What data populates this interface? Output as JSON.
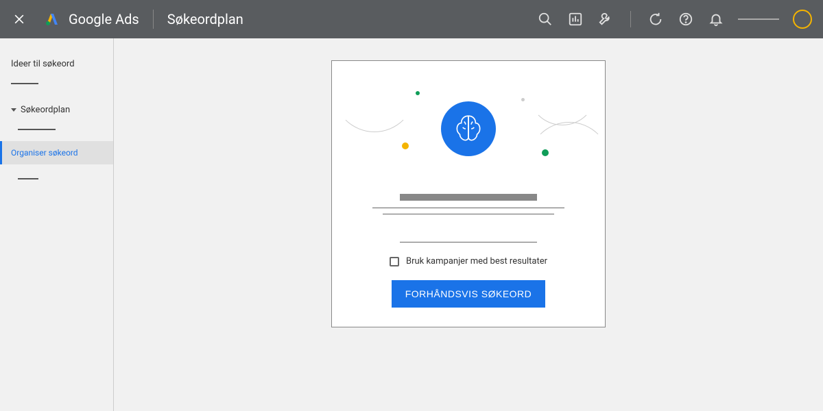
{
  "header": {
    "product": "Google Ads",
    "title": "Søkeordplan"
  },
  "sidebar": {
    "item_ideas": "Ideer til søkeord",
    "item_plan": "Søkeordplan",
    "item_organize": "Organiser søkeord"
  },
  "card": {
    "checkbox_label": "Bruk kampanjer med best resultater",
    "preview_button": "FORHÅNDSVIS SØKEORD"
  }
}
